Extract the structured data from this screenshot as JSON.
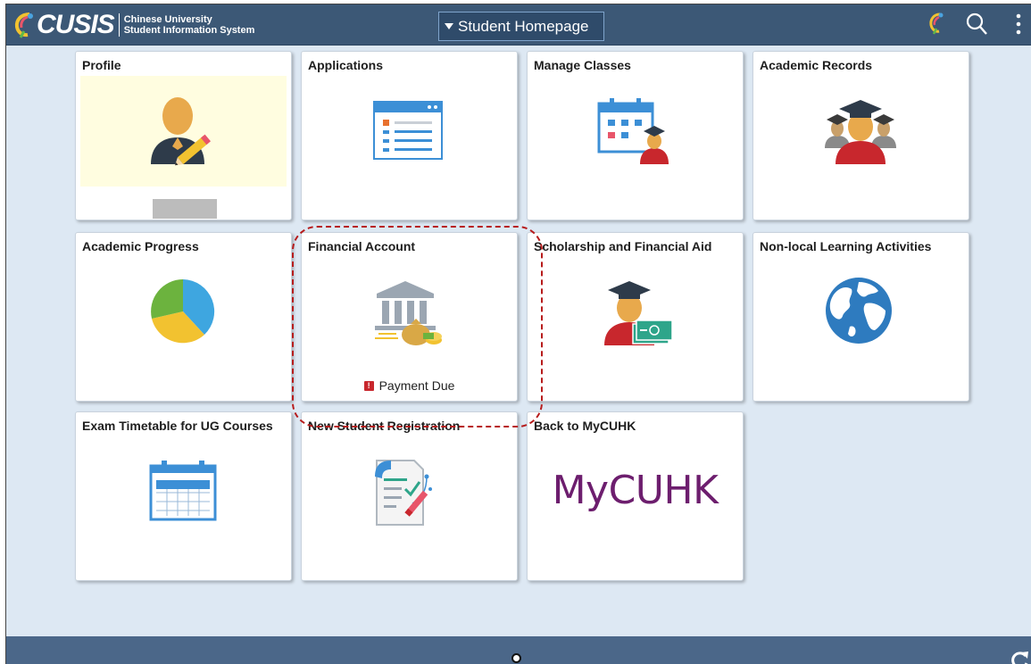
{
  "app": {
    "logo_text": "CUSIS",
    "subtitle_line1": "Chinese University",
    "subtitle_line2": "Student Information System"
  },
  "header": {
    "homepage_selector": "Student Homepage",
    "icons": [
      "navbar-icon",
      "search-icon",
      "more-actions-icon"
    ]
  },
  "tiles": {
    "profile": {
      "title": "Profile"
    },
    "applications": {
      "title": "Applications"
    },
    "manage_classes": {
      "title": "Manage Classes"
    },
    "academic_records": {
      "title": "Academic Records"
    },
    "academic_progress": {
      "title": "Academic Progress"
    },
    "financial_account": {
      "title": "Financial Account",
      "status": "Payment Due",
      "badge": "!"
    },
    "scholarship": {
      "title": "Scholarship and Financial Aid"
    },
    "nonlocal": {
      "title": "Non-local Learning Activities"
    },
    "exam_timetable": {
      "title": "Exam Timetable for UG Courses"
    },
    "new_student": {
      "title": "New Student Registration"
    },
    "back_mycuhk": {
      "title": "Back to MyCUHK",
      "logo_text": "MyCUHK"
    }
  },
  "footer": {
    "icons": [
      "page-indicator-dot",
      "refresh-icon"
    ]
  },
  "colors": {
    "header_bg": "#3c5876",
    "page_bg": "#dde8f3",
    "footer_bg": "#4b6789",
    "highlight": "#b71c1c",
    "mycuhk": "#6d1e6e"
  }
}
